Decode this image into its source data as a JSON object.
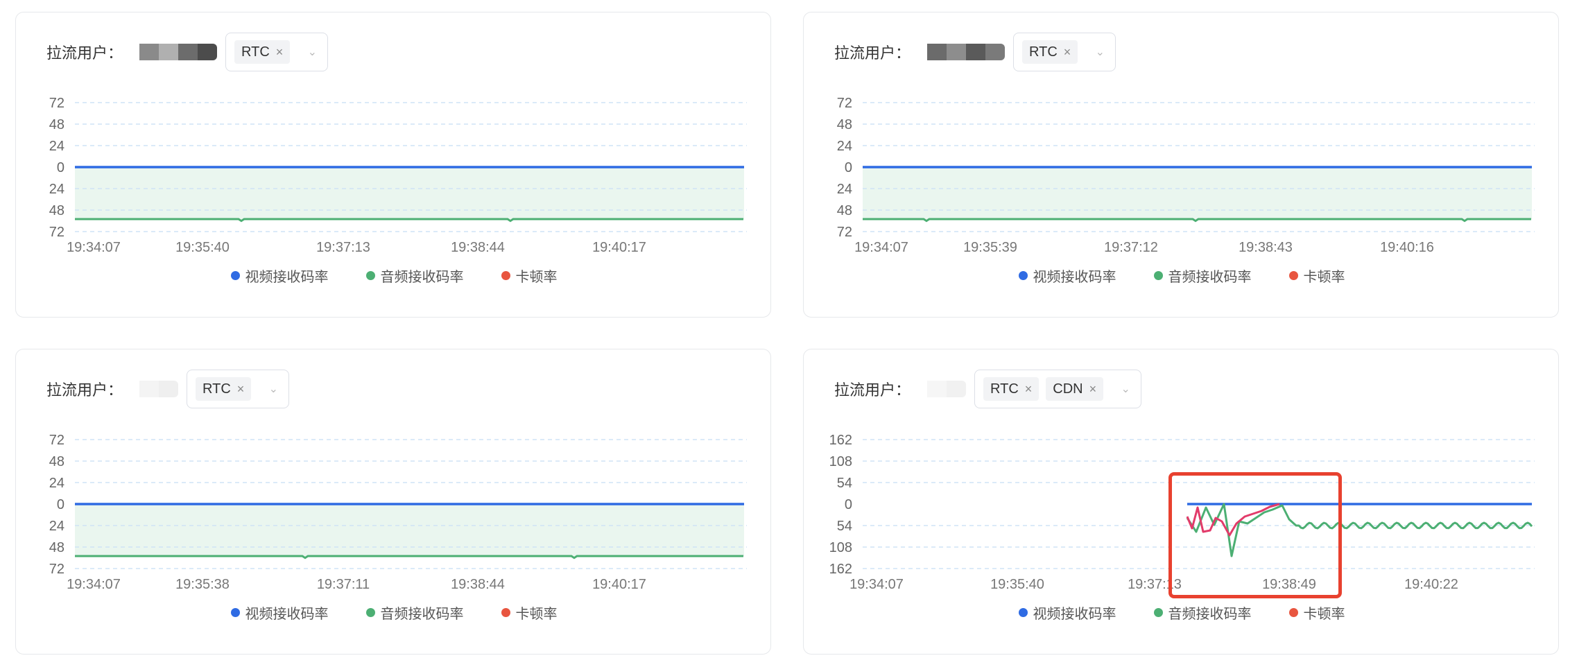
{
  "colors": {
    "video": "#2f6be3",
    "audio": "#4caf73",
    "stall": "#e8553f",
    "grid": "#cfe3f5",
    "area": "#eaf6ef",
    "highlight": "#e8412f"
  },
  "legend": [
    {
      "label": "视频接收码率",
      "color": "#2f6be3"
    },
    {
      "label": "音频接收码率",
      "color": "#4caf73"
    },
    {
      "label": "卡顿率",
      "color": "#e8553f"
    }
  ],
  "panels": [
    {
      "user_label": "拉流用户：",
      "tags": [
        "RTC"
      ],
      "mask_colors": [
        "#8a8a8a",
        "#b0b0b0",
        "#6c6c6c",
        "#4c4c4c"
      ],
      "chart_data": {
        "type": "line",
        "yticks": [
          "72",
          "48",
          "24",
          "0",
          "24",
          "48",
          "72"
        ],
        "ylim": [
          -72,
          72
        ],
        "xticks": [
          "19:34:07",
          "19:35:40",
          "19:37:13",
          "19:38:44",
          "19:40:17"
        ],
        "series": [
          {
            "name": "视频接收码率",
            "values_desc": "flat",
            "y": 0
          },
          {
            "name": "音频接收码率",
            "values_desc": "flat",
            "y": -56
          }
        ]
      }
    },
    {
      "user_label": "拉流用户：",
      "tags": [
        "RTC"
      ],
      "mask_colors": [
        "#6b6b6b",
        "#8d8d8d",
        "#5a5a5a",
        "#7a7a7a"
      ],
      "chart_data": {
        "type": "line",
        "yticks": [
          "72",
          "48",
          "24",
          "0",
          "24",
          "48",
          "72"
        ],
        "ylim": [
          -72,
          72
        ],
        "xticks": [
          "19:34:07",
          "19:35:39",
          "19:37:12",
          "19:38:43",
          "19:40:16"
        ],
        "series": [
          {
            "name": "视频接收码率",
            "values_desc": "flat",
            "y": 0
          },
          {
            "name": "音频接收码率",
            "values_desc": "flat",
            "y": -56
          }
        ]
      }
    },
    {
      "user_label": "拉流用户：",
      "tags": [
        "RTC"
      ],
      "mask_colors": [
        "#f4f4f4",
        "#efefef"
      ],
      "chart_data": {
        "type": "line",
        "yticks": [
          "72",
          "48",
          "24",
          "0",
          "24",
          "48",
          "72"
        ],
        "ylim": [
          -72,
          72
        ],
        "xticks": [
          "19:34:07",
          "19:35:38",
          "19:37:11",
          "19:38:44",
          "19:40:17"
        ],
        "series": [
          {
            "name": "视频接收码率",
            "values_desc": "flat",
            "y": 0
          },
          {
            "name": "音频接收码率",
            "values_desc": "flat",
            "y": -56
          }
        ]
      }
    },
    {
      "user_label": "拉流用户：",
      "tags": [
        "RTC",
        "CDN"
      ],
      "mask_colors": [
        "#f6f6f6",
        "#f1f1f1"
      ],
      "chart_data": {
        "type": "line",
        "yticks": [
          "162",
          "108",
          "54",
          "0",
          "54",
          "108",
          "162"
        ],
        "ylim": [
          -162,
          162
        ],
        "xticks": [
          "19:34:07",
          "19:35:40",
          "19:37:13",
          "19:38:49",
          "19:40:22"
        ],
        "series": [
          {
            "name": "视频接收码率",
            "values_desc": "flat from 19:38:10",
            "y": 0
          },
          {
            "name": "音频接收码率",
            "values_desc": "oscillating around -54 after spike"
          },
          {
            "name": "卡顿率",
            "values_desc": "spiky segment near 19:38"
          }
        ]
      }
    }
  ]
}
